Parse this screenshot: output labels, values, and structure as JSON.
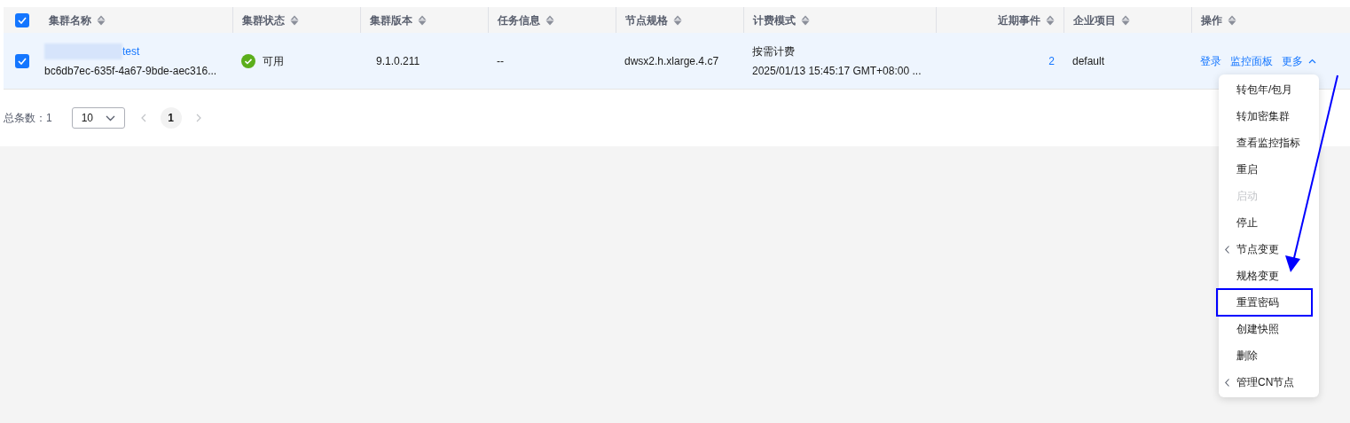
{
  "table": {
    "select_all": {
      "checked": true
    },
    "columns": [
      {
        "label": "集群名称"
      },
      {
        "label": "集群状态"
      },
      {
        "label": "集群版本"
      },
      {
        "label": "任务信息"
      },
      {
        "label": "节点规格"
      },
      {
        "label": "计费模式"
      },
      {
        "label": "近期事件"
      },
      {
        "label": "企业项目"
      },
      {
        "label": "操作"
      }
    ],
    "rows": [
      {
        "checked": true,
        "name": "test",
        "id": "bc6db7ec-635f-4a67-9bde-aec316...",
        "status": "可用",
        "version": "9.1.0.211",
        "task": "--",
        "spec": "dwsx2.h.xlarge.4.c7",
        "billing": "按需计费",
        "billing_time": "2025/01/13 15:45:17 GMT+08:00 ...",
        "events": "2",
        "project": "default",
        "actions": [
          "登录",
          "监控面板"
        ],
        "more": {
          "label": "更多",
          "expanded": true
        }
      }
    ]
  },
  "pagination": {
    "total_label": "总条数：",
    "total": "1",
    "page_size": "10",
    "pages": [
      {
        "label": "1",
        "selected": true
      }
    ]
  },
  "menu": [
    {
      "label": "转包年/包月",
      "disabled": false,
      "submenu": false,
      "highlighted": false
    },
    {
      "label": "转加密集群",
      "disabled": false,
      "submenu": false,
      "highlighted": false
    },
    {
      "label": "查看监控指标",
      "disabled": false,
      "submenu": false,
      "highlighted": false
    },
    {
      "label": "重启",
      "disabled": false,
      "submenu": false,
      "highlighted": false
    },
    {
      "label": "启动",
      "disabled": true,
      "submenu": false,
      "highlighted": false
    },
    {
      "label": "停止",
      "disabled": false,
      "submenu": false,
      "highlighted": false
    },
    {
      "label": "节点变更",
      "disabled": false,
      "submenu": true,
      "highlighted": false
    },
    {
      "label": "规格变更",
      "disabled": false,
      "submenu": false,
      "highlighted": false
    },
    {
      "label": "重置密码",
      "disabled": false,
      "submenu": false,
      "highlighted": true
    },
    {
      "label": "创建快照",
      "disabled": false,
      "submenu": false,
      "highlighted": false
    },
    {
      "label": "删除",
      "disabled": false,
      "submenu": false,
      "highlighted": false
    },
    {
      "label": "管理CN节点",
      "disabled": false,
      "submenu": true,
      "highlighted": false
    }
  ]
}
